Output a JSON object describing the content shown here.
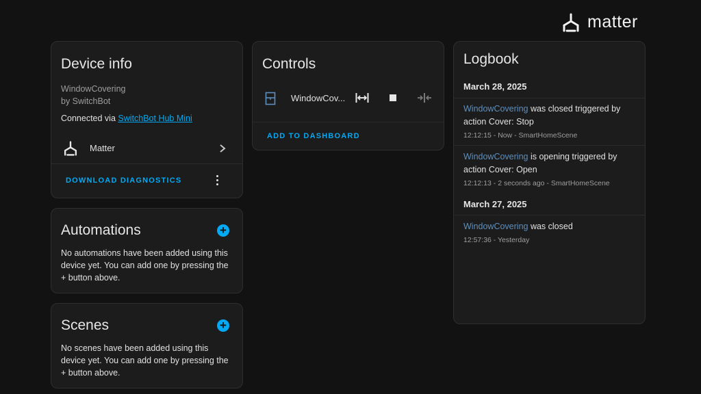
{
  "brand": {
    "name": "matter"
  },
  "device_info": {
    "title": "Device info",
    "model": "WindowCovering",
    "by": "by SwitchBot",
    "connected_prefix": "Connected via ",
    "connected_link": "SwitchBot Hub Mini",
    "integration_label": "Matter",
    "download_label": "DOWNLOAD DIAGNOSTICS"
  },
  "automations": {
    "title": "Automations",
    "text": "No automations have been added using this device yet. You can add one by pressing the + button above."
  },
  "scenes": {
    "title": "Scenes",
    "text": "No scenes have been added using this device yet. You can add one by pressing the + button above."
  },
  "controls": {
    "title": "Controls",
    "entity_name": "WindowCov...",
    "add_label": "ADD TO DASHBOARD"
  },
  "logbook": {
    "title": "Logbook",
    "groups": [
      {
        "date": "March 28, 2025",
        "entries": [
          {
            "entity": "WindowCovering",
            "text": " was closed triggered by action Cover: Stop",
            "meta": "12:12:15 - Now - SmartHomeScene"
          },
          {
            "entity": "WindowCovering",
            "text": " is opening triggered by action Cover: Open",
            "meta": "12:12:13 - 2 seconds ago - SmartHomeScene"
          }
        ]
      },
      {
        "date": "March 27, 2025",
        "entries": [
          {
            "entity": "WindowCovering",
            "text": " was closed",
            "meta": "12:57:36 - Yesterday"
          }
        ]
      }
    ]
  },
  "colors": {
    "accent": "#03a9f4",
    "background": "#121212",
    "card": "#1c1c1c"
  }
}
